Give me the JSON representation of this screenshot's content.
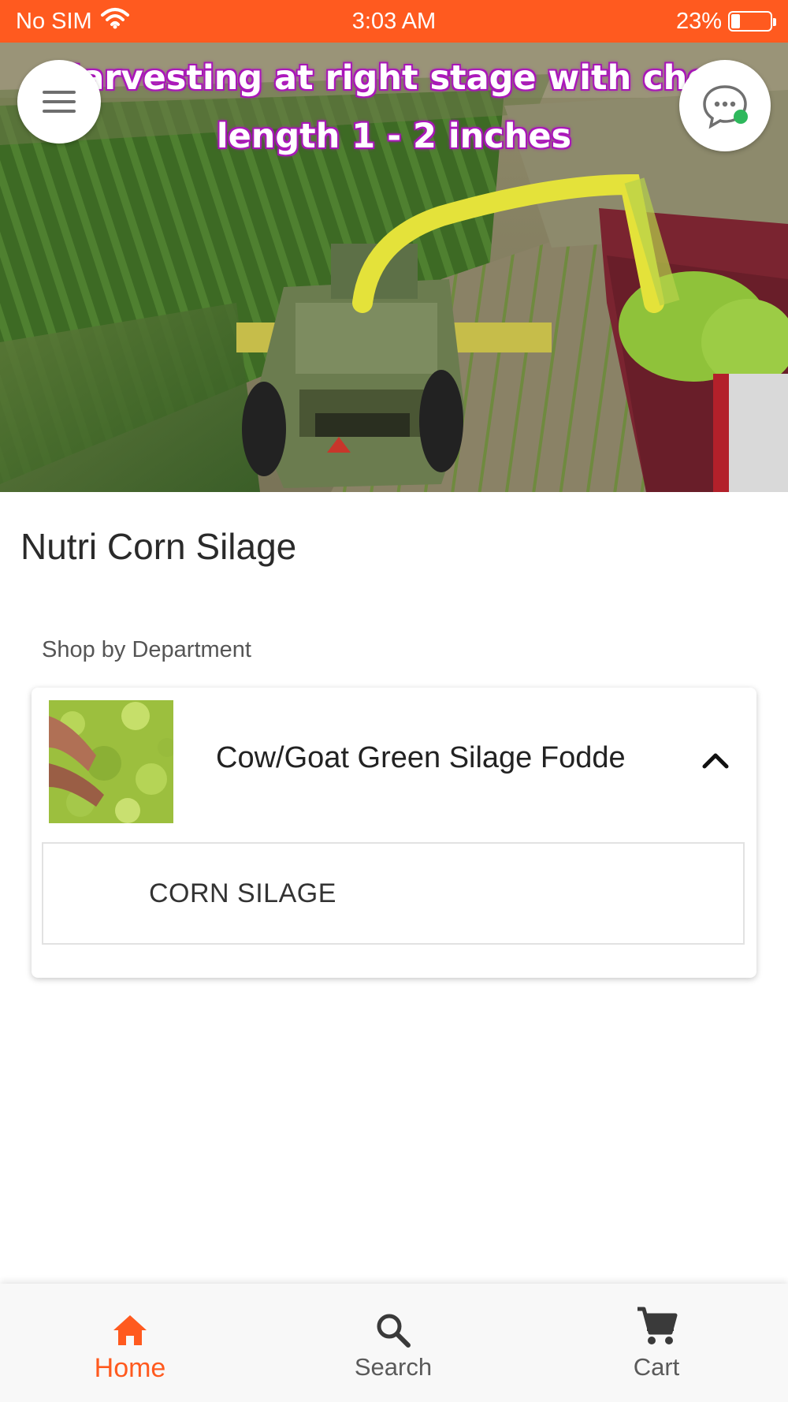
{
  "status_bar": {
    "carrier": "No SIM",
    "time": "3:03 AM",
    "battery_text": "23%",
    "battery_level": 0.23,
    "icons": [
      "wifi-icon",
      "battery-icon"
    ]
  },
  "hero": {
    "caption_line1": "Harvesting at right stage with chop",
    "caption_line2": "length 1 - 2 inches",
    "icons": [
      "menu-icon",
      "chat-icon"
    ]
  },
  "page": {
    "title": "Nutri Corn Silage",
    "section_label": "Shop by Department"
  },
  "department": {
    "name": "Cow/Goat Green Silage Fodde",
    "expanded": true,
    "chevron_icon": "chevron-up-icon",
    "items": [
      {
        "label": "CORN SILAGE"
      }
    ]
  },
  "tab_bar": {
    "tabs": [
      {
        "label": "Home",
        "icon": "home-icon",
        "active": true
      },
      {
        "label": "Search",
        "icon": "search-icon",
        "active": false
      },
      {
        "label": "Cart",
        "icon": "cart-icon",
        "active": false
      }
    ]
  },
  "colors": {
    "accent": "#ff5a1f",
    "caption_outline": "#a414b3",
    "chat_status_dot": "#2eb85c"
  }
}
